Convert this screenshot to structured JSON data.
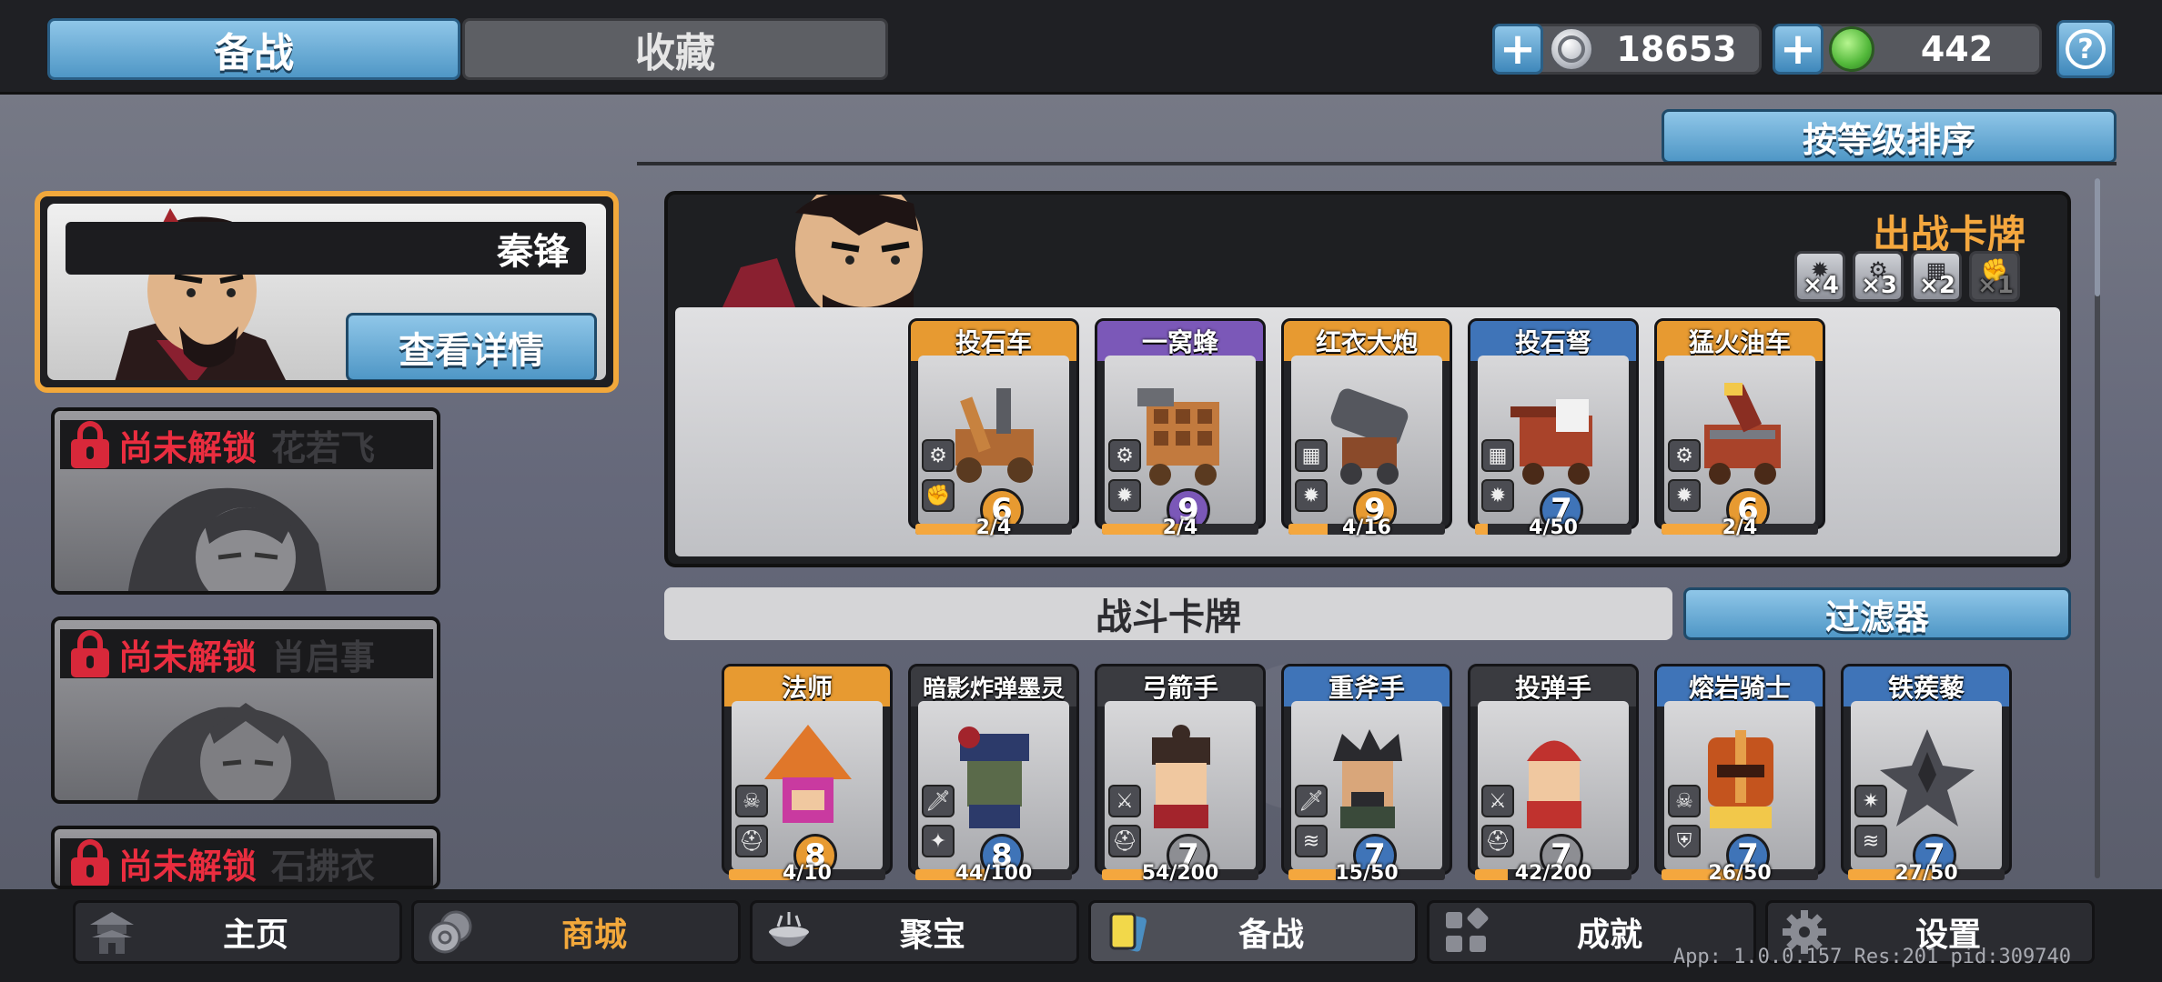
{
  "tabs": {
    "active": "备战",
    "inactive": "收藏"
  },
  "currencies": [
    {
      "icon": "silver-coin-icon",
      "value": "18653"
    },
    {
      "icon": "green-gem-icon",
      "value": "442"
    }
  ],
  "help_label": "?",
  "sort_button": "按等级排序",
  "selected_hero": {
    "name": "秦锋",
    "detail_button": "查看详情"
  },
  "locked_heroes": [
    {
      "status": "尚未解锁",
      "name": "花若飞"
    },
    {
      "status": "尚未解锁",
      "name": "肖启事"
    },
    {
      "status": "尚未解锁",
      "name": "石拂衣"
    }
  ],
  "deploy": {
    "title": "出战卡牌",
    "slots": [
      {
        "icon": "sun-icon",
        "mult": "×4"
      },
      {
        "icon": "gear-icon",
        "mult": "×3"
      },
      {
        "icon": "brick-icon",
        "mult": "×2"
      },
      {
        "icon": "fist-icon",
        "mult": "×1"
      }
    ],
    "cards": [
      {
        "name": "投石车",
        "level": "6",
        "progress": "2/4",
        "rarity": "orange"
      },
      {
        "name": "一窝蜂",
        "level": "9",
        "progress": "2/4",
        "rarity": "purple"
      },
      {
        "name": "红衣大炮",
        "level": "9",
        "progress": "4/16",
        "rarity": "orange"
      },
      {
        "name": "投石弩",
        "level": "7",
        "progress": "4/50",
        "rarity": "blue"
      },
      {
        "name": "猛火油车",
        "level": "6",
        "progress": "2/4",
        "rarity": "orange"
      }
    ]
  },
  "battle": {
    "title": "战斗卡牌",
    "filter_button": "过滤器",
    "cards": [
      {
        "name": "法师",
        "level": "8",
        "progress": "4/10",
        "rarity": "orange"
      },
      {
        "name": "暗影炸弹墨灵",
        "level": "8",
        "progress": "44/100",
        "rarity": "grey"
      },
      {
        "name": "弓箭手",
        "level": "7",
        "progress": "54/200",
        "rarity": "grey"
      },
      {
        "name": "重斧手",
        "level": "7",
        "progress": "15/50",
        "rarity": "blue"
      },
      {
        "name": "投弹手",
        "level": "7",
        "progress": "42/200",
        "rarity": "grey"
      },
      {
        "name": "熔岩骑士",
        "level": "7",
        "progress": "26/50",
        "rarity": "blue"
      },
      {
        "name": "铁蒺藜",
        "level": "7",
        "progress": "27/50",
        "rarity": "blue"
      }
    ]
  },
  "nav": [
    {
      "label": "主页",
      "icon": "pagoda-icon"
    },
    {
      "label": "商城",
      "icon": "coins-icon",
      "highlight": true
    },
    {
      "label": "聚宝",
      "icon": "treasure-bowl-icon"
    },
    {
      "label": "备战",
      "icon": "cards-icon",
      "active": true
    },
    {
      "label": "成就",
      "icon": "grid-icon"
    },
    {
      "label": "设置",
      "icon": "gear-icon"
    }
  ],
  "version": "App: 1.0.0.157 Res:201 pid:309740",
  "colors": {
    "accent_blue": "#4f97c6",
    "accent_orange": "#f2a83b",
    "lock_red": "#ea2d3f"
  }
}
